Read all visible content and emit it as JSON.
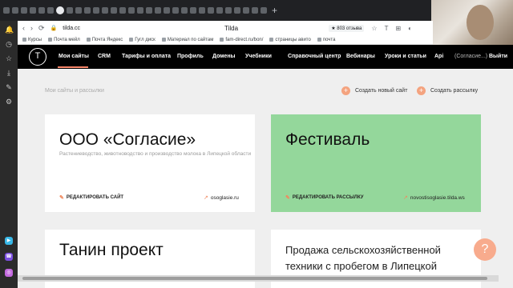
{
  "browser": {
    "window_title": "Tilda",
    "url": "tilda.cc",
    "review_badge": "★ 803 отзыва",
    "tab_count": 30,
    "active_tab_index": 6,
    "bookmarks": [
      "Курсы",
      "Почта мейл",
      "Почта Яндекс",
      "Гугл диск",
      "Материал по сайтам",
      "fam-direct.ru/bon/",
      "страницы авито",
      "почта"
    ]
  },
  "tilda_nav": {
    "logo_letter": "T",
    "items": [
      "Мои сайты",
      "CRM",
      "Тарифы и оплата",
      "Профиль",
      "Домены",
      "Учебники",
      "Справочный центр",
      "Вебинары",
      "Уроки и статьи",
      "Api"
    ],
    "account": "(Согласие...)",
    "logout": "Выйти"
  },
  "page": {
    "breadcrumb": "Мои сайты и рассылки",
    "create_site": "Создать новый сайт",
    "create_mailing": "Создать рассылку"
  },
  "cards": [
    {
      "title": "ООО «Согласие»",
      "description": "Растениеводство, животноводство и производство молока в Липецкой области",
      "edit_label": "РЕДАКТИРОВАТЬ САЙТ",
      "domain": "osoglasie.ru"
    },
    {
      "title": "Фестиваль",
      "edit_label": "РЕДАКТИРОВАТЬ РАССЫЛКУ",
      "domain": "novostisoglasie.tilda.ws",
      "color": "#94d79b"
    },
    {
      "title": "Танин проект"
    },
    {
      "body": "Продажа сельскохозяйственной техники с пробегом в Липецкой"
    }
  ],
  "fab": {
    "label": "?"
  },
  "colors": {
    "accent": "#fa876b",
    "green_card": "#94d79b",
    "nav_bg": "#000000"
  }
}
